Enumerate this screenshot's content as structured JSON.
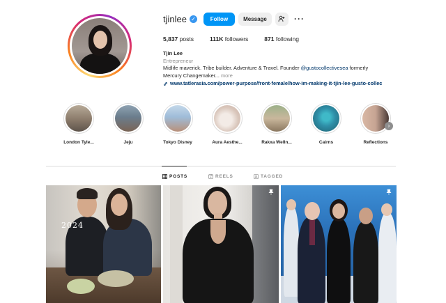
{
  "profile": {
    "username": "tjinlee",
    "follow_label": "Follow",
    "message_label": "Message",
    "stats": {
      "posts_count": "5,837",
      "posts_label": "posts",
      "followers_count": "111K",
      "followers_label": "followers",
      "following_count": "871",
      "following_label": "following"
    },
    "bio": {
      "name": "Tjin Lee",
      "category": "Entrepreneur",
      "line1": "Midlife maverick. Tribe builder. Adventure & Travel. Founder ",
      "mention": "@gustocollectivesea",
      "line1_end": " formerly",
      "line2": "Mercury Changemaker... ",
      "more": "more",
      "link": "www.tatlerasia.com/power-purpose/front-female/how-im-making-it-tjin-lee-gusto-collec"
    }
  },
  "highlights": [
    {
      "label": "London Tyle...",
      "colors": [
        "#8a7a6a",
        "#c9b8a0"
      ]
    },
    {
      "label": "Jeju",
      "colors": [
        "#6b7d8c",
        "#a89583"
      ]
    },
    {
      "label": "Tokyo Disney",
      "colors": [
        "#9fbcd8",
        "#d2c1a8"
      ]
    },
    {
      "label": "Aura Aesthe...",
      "colors": [
        "#e7dcd6",
        "#c9b1a6"
      ]
    },
    {
      "label": "Rakxa Welln...",
      "colors": [
        "#b9a88f",
        "#7f9a6a"
      ]
    },
    {
      "label": "Cairns",
      "colors": [
        "#2f8fa8",
        "#1f5f6e"
      ]
    },
    {
      "label": "Reflections",
      "colors": [
        "#c6a493",
        "#4a3a36"
      ]
    }
  ],
  "tabs": {
    "posts": "POSTS",
    "reels": "REELS",
    "tagged": "TAGGED"
  },
  "posts": [
    {
      "overlay_text": "2024",
      "pinned": false
    },
    {
      "overlay_text": "",
      "pinned": true
    },
    {
      "overlay_text": "",
      "pinned": true
    }
  ],
  "colors": {
    "accent": "#0095f6",
    "verified": "#3897f0",
    "link": "#00376b"
  },
  "icons": {
    "verified": "verified-badge-icon",
    "suggest": "person-add-icon",
    "more": "more-horizontal-icon",
    "link": "link-icon",
    "posts_tab": "grid-icon",
    "reels_tab": "reels-icon",
    "tagged_tab": "tag-icon",
    "pin": "pin-icon",
    "next": "chevron-right-icon"
  }
}
